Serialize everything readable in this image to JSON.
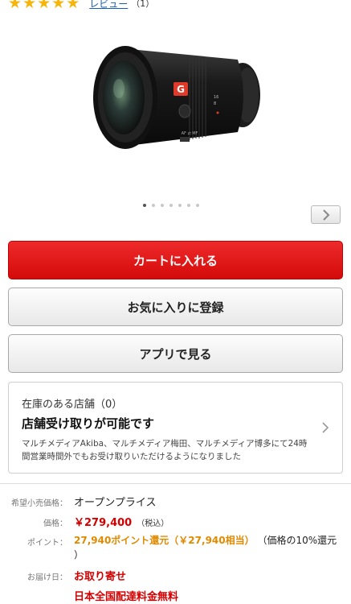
{
  "rating": {
    "stars": 5,
    "review_link": "レビュー",
    "review_count": "（1）"
  },
  "product_image": {
    "alt": "ソニー カメラレンズ",
    "g_badge": "G",
    "af_label": "AF ⇄ MF"
  },
  "carousel": {
    "total": 7,
    "active": 0
  },
  "buttons": {
    "cart": "カートに入れる",
    "favorite": "お気に入りに登録",
    "app": "アプリで見る"
  },
  "store": {
    "title": "在庫のある店舗（0）",
    "heading": "店舗受け取りが可能です",
    "description": "マルチメディアAkiba、マルチメディア梅田、マルチメディア博多にて24時間営業時間外でもお受け取りいただけるようになりました"
  },
  "specs": {
    "msrp_label": "希望小売価格：",
    "msrp_value": "オープンプライス",
    "price_label": "価格：",
    "price_value": "￥279,400",
    "tax_note": "（税込）",
    "points_label": "ポイント：",
    "points_value": "27,940ポイント還元（￥27,940相当）",
    "points_note_line1": "（価格の10%還元",
    "points_note_line2": "）",
    "delivery_label": "お届け日：",
    "delivery_value": "お取り寄せ",
    "shipping_value": "日本全国配達料金無料"
  },
  "colors": {
    "accent_red": "#d40000",
    "star_gold": "#f5b50a",
    "link_blue": "#1a5fb4",
    "points_orange": "#e08a00"
  }
}
